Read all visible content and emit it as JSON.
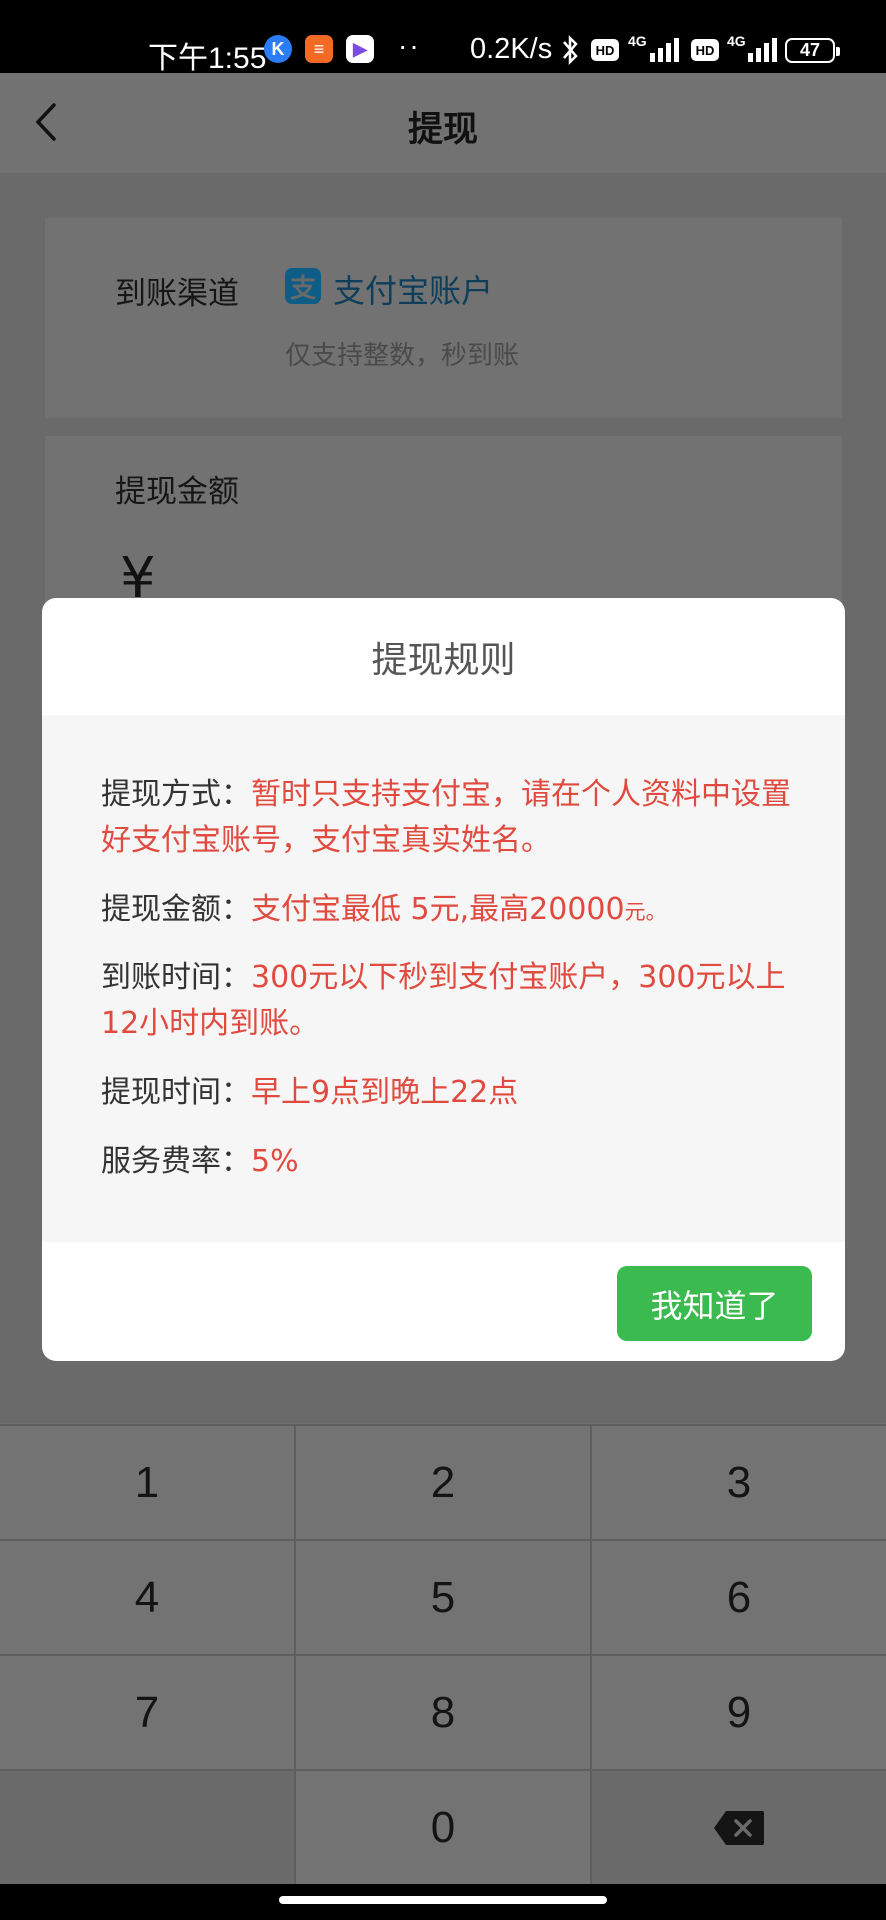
{
  "status_bar": {
    "time": "下午1:55",
    "app_badges": [
      "K",
      "≡",
      "▶"
    ],
    "dots": "··",
    "net_speed": "0.2K/s",
    "hd1": "HD",
    "net1": "4G",
    "hd2": "HD",
    "net2": "4G",
    "battery": "47",
    "colors": {
      "badge_k": "#2a7df6",
      "badge_2": "#f36a24",
      "badge_3": "#ffffff"
    }
  },
  "navbar": {
    "title": "提现",
    "back_icon": "chevron-left-icon"
  },
  "form": {
    "channel_label": "到账渠道",
    "channel_icon": "alipay-icon",
    "channel_icon_glyph": "支",
    "channel_value": "支付宝账户",
    "channel_hint": "仅支持整数，秒到账",
    "amount_label": "提现金额",
    "currency_symbol": "¥"
  },
  "dialog": {
    "title": "提现规则",
    "rules": [
      {
        "label": "提现方式：",
        "value": "暂时只支持支付宝，请在个人资料中设置好支付宝账号，支付宝真实姓名。"
      },
      {
        "label": "提现金额：",
        "value": "支付宝最低 5元,最高20000",
        "suffix": "元。"
      },
      {
        "label": "到账时间：",
        "value": "300元以下秒到支付宝账户，300元以上12小时内到账。"
      },
      {
        "label": "提现时间：",
        "value": "早上9点到晚上22点"
      },
      {
        "label": "服务费率：",
        "value": "5%"
      }
    ],
    "ok_label": "我知道了",
    "colors": {
      "rule_value": "#e04a3f",
      "button": "#3bba4f"
    }
  },
  "keypad": {
    "keys": [
      "1",
      "2",
      "3",
      "4",
      "5",
      "6",
      "7",
      "8",
      "9",
      "",
      "0",
      "delete"
    ],
    "delete_icon": "backspace-icon"
  }
}
